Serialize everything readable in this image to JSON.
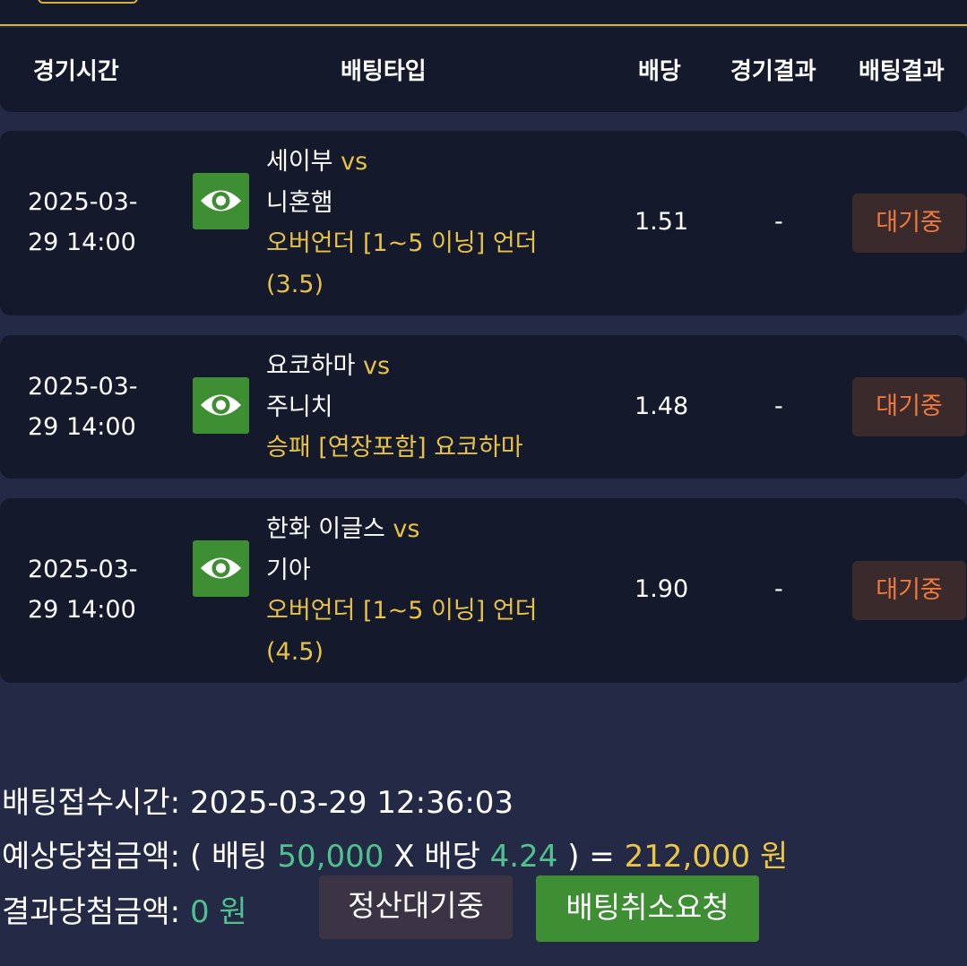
{
  "header": {
    "col_time": "경기시간",
    "col_type": "배팅타입",
    "col_odds": "배당",
    "col_game_result": "경기결과",
    "col_bet_result": "배팅결과"
  },
  "bets": [
    {
      "time_line1": "2025-03-",
      "time_line2": "29 14:00",
      "home": "세이부",
      "vs": "vs",
      "away": "니혼햄",
      "bet_type_line1": "오버언더 [1~5 이닝] 언더",
      "bet_type_line2": "(3.5)",
      "odds": "1.51",
      "game_result": "-",
      "status": "대기중"
    },
    {
      "time_line1": "2025-03-",
      "time_line2": "29 14:00",
      "home": "요코하마",
      "vs": "vs",
      "away": "주니치",
      "bet_type_line1": "승패 [연장포함] 요코하마",
      "bet_type_line2": "",
      "odds": "1.48",
      "game_result": "-",
      "status": "대기중"
    },
    {
      "time_line1": "2025-03-",
      "time_line2": "29 14:00",
      "home": "한화 이글스",
      "vs": "vs",
      "away": "기아",
      "bet_type_line1": "오버언더 [1~5 이닝] 언더",
      "bet_type_line2": "(4.5)",
      "odds": "1.90",
      "game_result": "-",
      "status": "대기중"
    }
  ],
  "footer": {
    "received_label": "배팅접수시간:",
    "received_value": "2025-03-29 12:36:03",
    "expected_label": "예상당첨금액:",
    "open_paren": "( 배팅",
    "stake": "50,000",
    "times_label": "X 배당",
    "total_odds": "4.24",
    "close_eq": ") =",
    "expected_amount": "212,000 원",
    "result_label": "결과당첨금액:",
    "result_amount": "0 원",
    "settle_button": "정산대기중",
    "cancel_button": "배팅취소요청"
  },
  "icons": {
    "watch": "eye-icon"
  },
  "colors": {
    "background": "#242a45",
    "card": "#141a2c",
    "accent_yellow": "#e8c245",
    "green": "#3e8e33",
    "status_orange": "#f07a3e",
    "money_green": "#4fc28f"
  }
}
